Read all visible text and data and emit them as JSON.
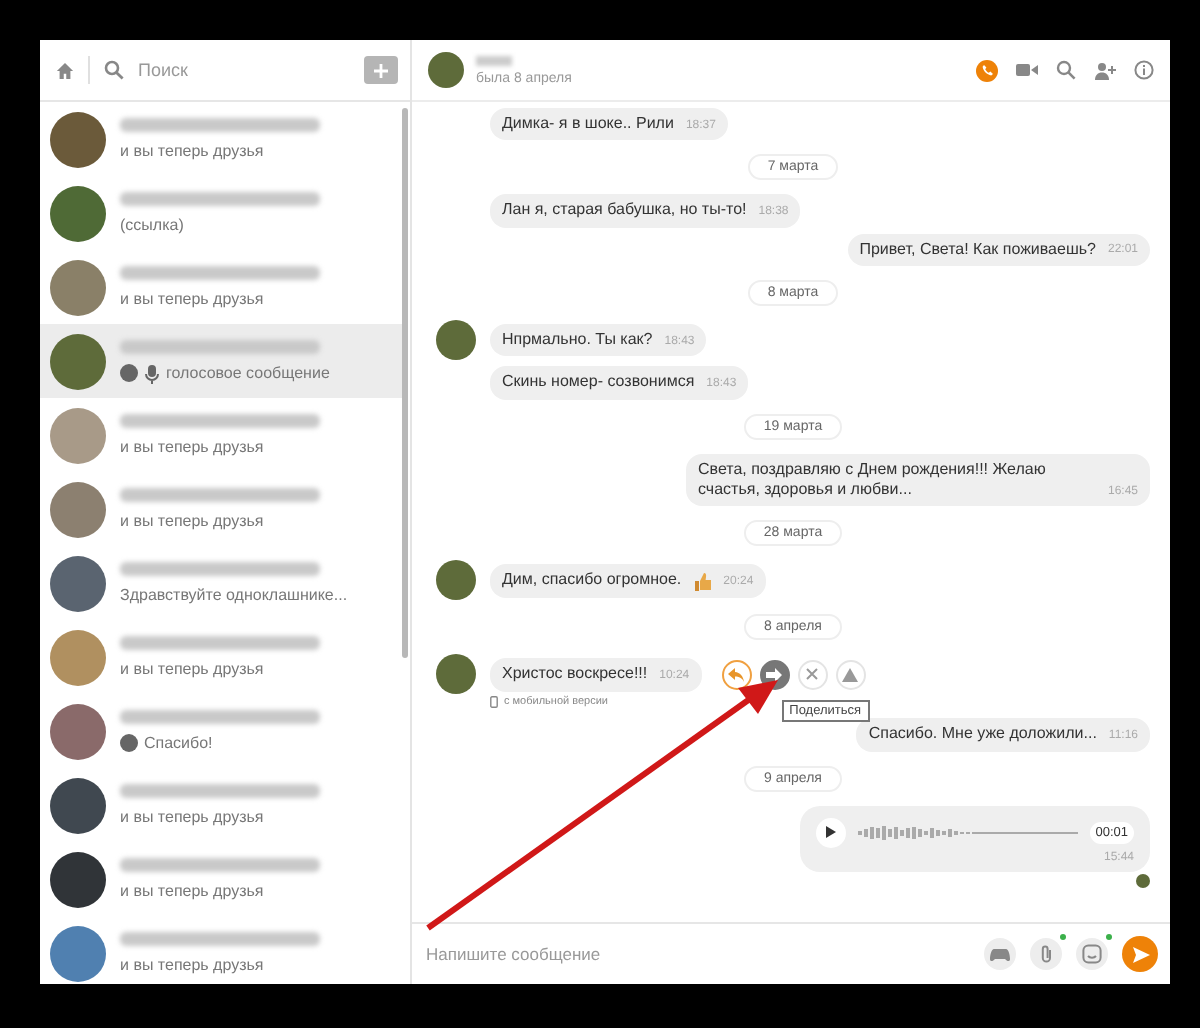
{
  "sidebar": {
    "search_placeholder": "Поиск",
    "contacts": [
      {
        "kind": "text",
        "preview": "и вы теперь друзья",
        "selected": false
      },
      {
        "kind": "text",
        "preview": "(ссылка)",
        "selected": false
      },
      {
        "kind": "text",
        "preview": "и вы теперь друзья",
        "selected": false
      },
      {
        "kind": "voice",
        "preview": "голосовое сообщение",
        "selected": true
      },
      {
        "kind": "text",
        "preview": "и вы теперь друзья",
        "selected": false
      },
      {
        "kind": "text",
        "preview": "и вы теперь друзья",
        "selected": false
      },
      {
        "kind": "text",
        "preview": "Здравствуйте одноклашнике...",
        "selected": false
      },
      {
        "kind": "text",
        "preview": "и вы теперь друзья",
        "selected": false
      },
      {
        "kind": "reply",
        "preview": "Спасибо!",
        "selected": false
      },
      {
        "kind": "text",
        "preview": "и вы теперь друзья",
        "selected": false
      },
      {
        "kind": "text",
        "preview": "и вы теперь друзья",
        "selected": false
      },
      {
        "kind": "text",
        "preview": "и вы теперь друзья",
        "selected": false
      }
    ]
  },
  "chat": {
    "status": "была 8 апреля",
    "messages": [
      {
        "kind": "in",
        "avatar": false,
        "text": "Димка- я в шоке.. Рили",
        "time": "18:37"
      },
      {
        "kind": "date",
        "text": "7 марта"
      },
      {
        "kind": "in",
        "avatar": false,
        "text": "Лан я, старая бабушка, но ты-то!",
        "time": "18:38"
      },
      {
        "kind": "out",
        "text": "Привет, Света! Как поживаешь?",
        "time": "22:01"
      },
      {
        "kind": "date",
        "text": "8 марта"
      },
      {
        "kind": "in",
        "avatar": true,
        "text": "Нпрмально. Ты как?",
        "time": "18:43"
      },
      {
        "kind": "in",
        "avatar": false,
        "text": "Скинь номер- созвонимся",
        "time": "18:43"
      },
      {
        "kind": "date",
        "text": "19 марта"
      },
      {
        "kind": "out",
        "text": "Света, поздравляю с Днем рождения!!! Желаю счастья, здоровья и любви...",
        "time": "16:45"
      },
      {
        "kind": "date",
        "text": "28 марта"
      },
      {
        "kind": "in",
        "avatar": true,
        "sticker": true,
        "text": "Дим, спасибо огромное.",
        "time": "20:24"
      },
      {
        "kind": "date",
        "text": "8 апреля"
      },
      {
        "kind": "in",
        "avatar": true,
        "text": "Христос воскресе!!!",
        "time": "10:24",
        "note": "с мобильной версии",
        "tooltip": "Поделиться",
        "actions": [
          {
            "kind": "reply",
            "selected": false
          },
          {
            "kind": "share",
            "selected": true
          },
          {
            "kind": "close",
            "selected": false
          },
          {
            "kind": "report",
            "selected": false
          }
        ]
      },
      {
        "kind": "out",
        "text": "Спасибо. Мне уже доложили...",
        "time": "11:16"
      },
      {
        "kind": "date",
        "text": "9 апреля"
      },
      {
        "kind": "voice",
        "duration": "00:01",
        "time": "15:44",
        "seen": true
      }
    ],
    "input_placeholder": "Напишите сообщение"
  }
}
